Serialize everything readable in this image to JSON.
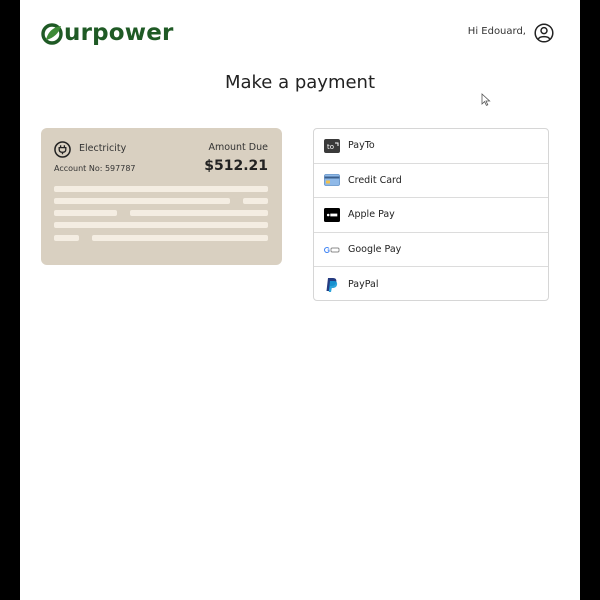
{
  "header": {
    "logo_text": "urpower",
    "greeting": "Hi Edouard,",
    "brand_color": "#1f5a25"
  },
  "page": {
    "title": "Make a payment"
  },
  "bill": {
    "type": "Electricity",
    "account": "Account No: 597787",
    "due_label": "Amount Due",
    "due_amount": "$512.21",
    "card_color": "#d9d0c1"
  },
  "payment_options": [
    {
      "label": "PayTo",
      "icon": "payto-icon"
    },
    {
      "label": "Credit Card",
      "icon": "credit-card-icon"
    },
    {
      "label": "Apple Pay",
      "icon": "apple-pay-icon"
    },
    {
      "label": "Google Pay",
      "icon": "google-pay-icon"
    },
    {
      "label": "PayPal",
      "icon": "paypal-icon"
    }
  ]
}
